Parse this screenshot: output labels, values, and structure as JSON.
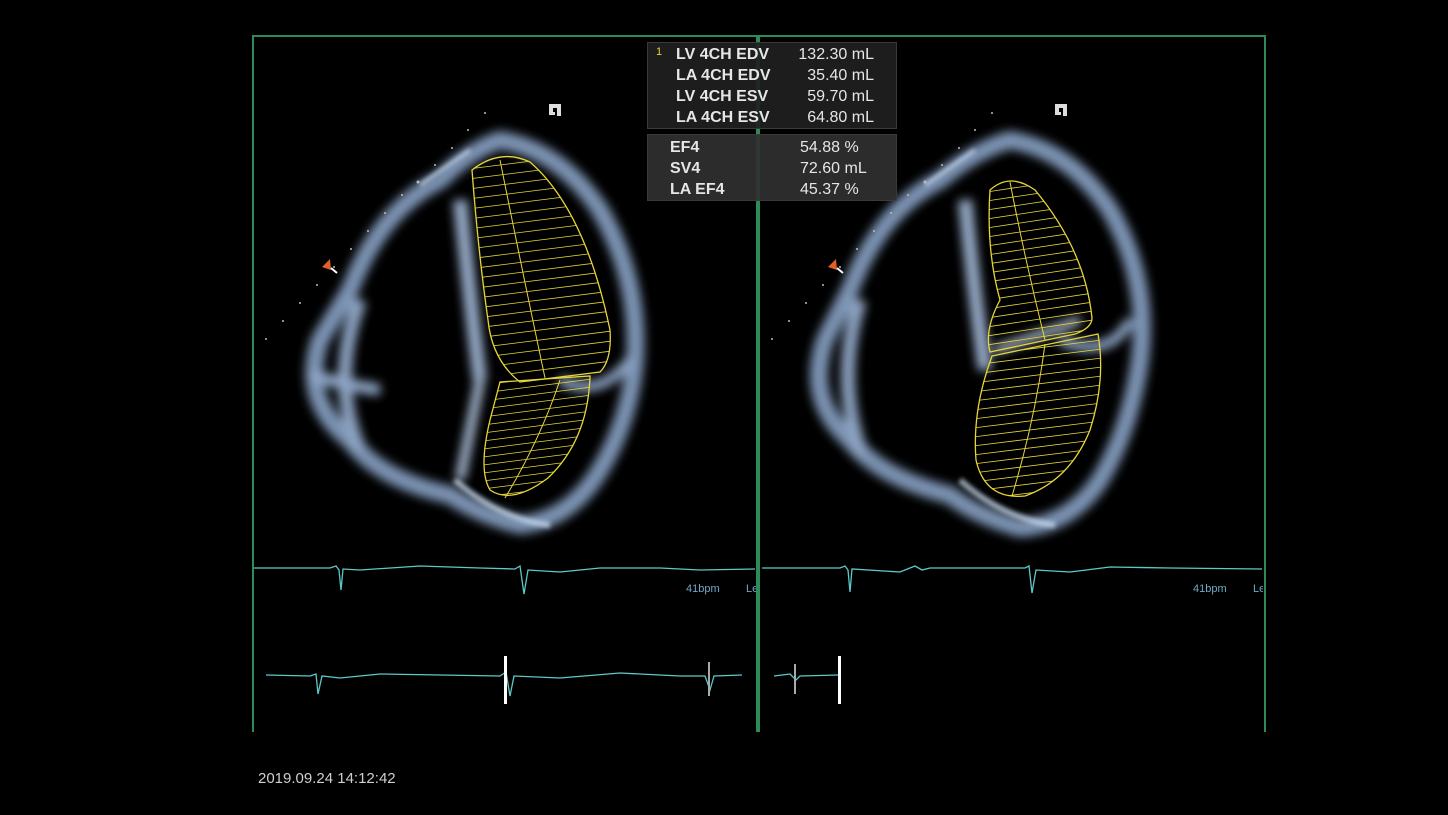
{
  "measurements": {
    "index": "1",
    "volumes": [
      {
        "label": "LV 4CH EDV",
        "value": "132.30 mL"
      },
      {
        "label": "LA 4CH EDV",
        "value": "35.40 mL"
      },
      {
        "label": "LV 4CH ESV",
        "value": "59.70 mL"
      },
      {
        "label": "LA 4CH ESV",
        "value": "64.80 mL"
      }
    ],
    "results": [
      {
        "label": "EF4",
        "value": "54.88 %"
      },
      {
        "label": "SV4",
        "value": "72.60 mL"
      },
      {
        "label": "LA EF4",
        "value": "45.37 %"
      }
    ]
  },
  "panels": {
    "left": {
      "heart_rate": "41bpm",
      "lead": "Le"
    },
    "right": {
      "heart_rate": "41bpm",
      "lead": "Le"
    }
  },
  "timestamp": "2019.09.24 14:12:42",
  "colors": {
    "frame": "#2e8b57",
    "trace": "#e6d63a",
    "ecg": "#5fc8c8",
    "orientation_marker": "#e0602a"
  }
}
